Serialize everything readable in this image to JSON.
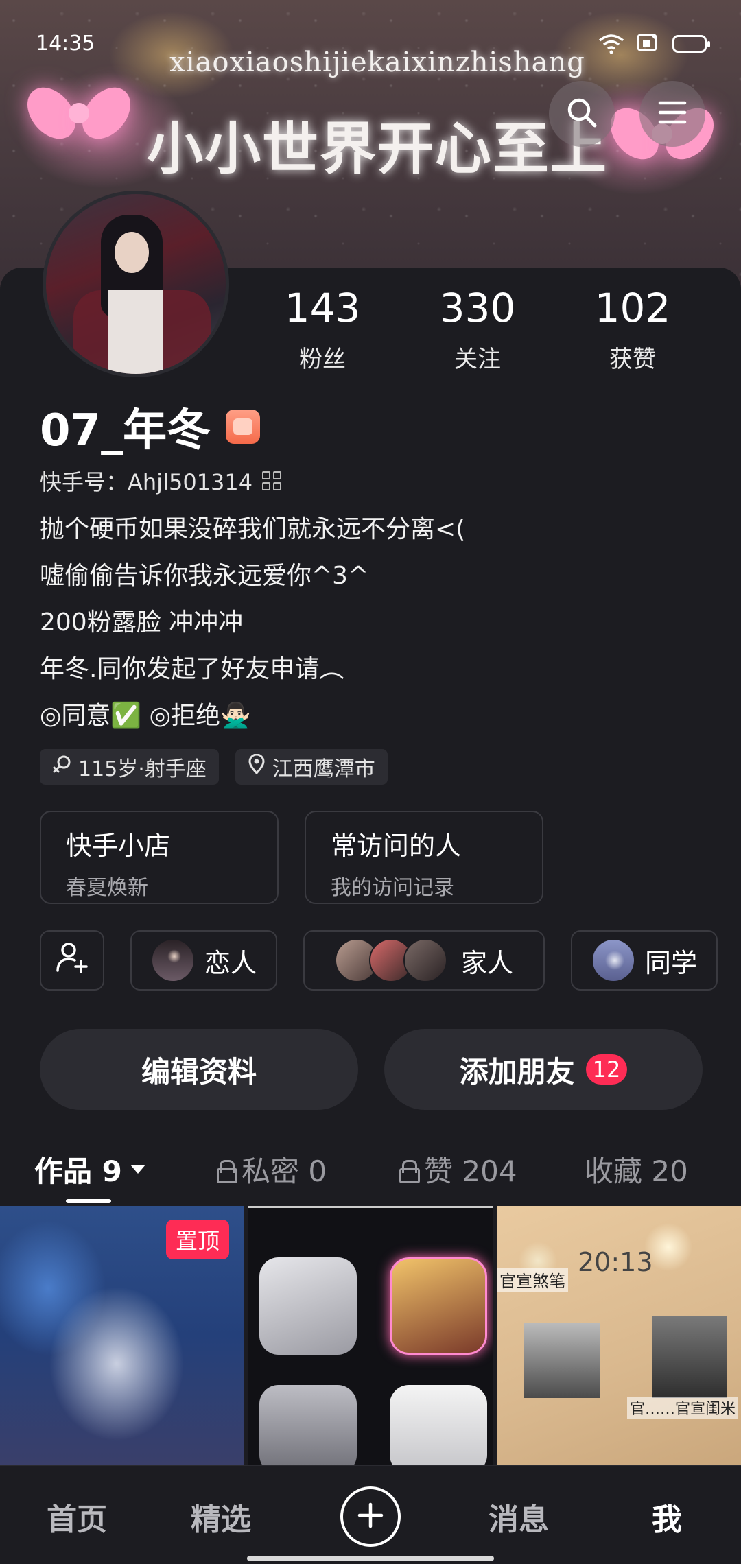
{
  "status_bar": {
    "time": "14:35"
  },
  "banner": {
    "subtitle": "xiaoxiaoshijiekaixinzhishang",
    "title": "小小世界开心至上"
  },
  "header": {
    "search_icon": "search-icon",
    "menu_icon": "menu-icon"
  },
  "stats": [
    {
      "value": "143",
      "label": "粉丝"
    },
    {
      "value": "330",
      "label": "关注"
    },
    {
      "value": "102",
      "label": "获赞"
    }
  ],
  "profile": {
    "name": "07_年冬",
    "kuaishou_id": "快手号：Ahjl501314",
    "bio": [
      "抛个硬币如果没碎我们就永远不分离<(",
      "嘘偷偷告诉你我永远爱你^3^",
      "200粉露脸 冲冲冲",
      "年冬.同你发起了好友申请︵",
      "◎同意✅        ◎拒绝🙅🏻‍♂️"
    ]
  },
  "tags": [
    {
      "icon": "gender-icon",
      "label": "115岁·射手座"
    },
    {
      "icon": "location-icon",
      "label": "江西鹰潭市"
    }
  ],
  "cards": [
    {
      "title": "快手小店",
      "subtitle": "春夏焕新"
    },
    {
      "title": "常访问的人",
      "subtitle": "我的访问记录"
    }
  ],
  "relations": {
    "lover": "恋人",
    "family": "家人",
    "classmate": "同学"
  },
  "actions": {
    "edit": "编辑资料",
    "add_friend": "添加朋友",
    "add_friend_badge": "12"
  },
  "tabs": [
    {
      "label": "作品",
      "count": "9"
    },
    {
      "label": "私密",
      "count": "0"
    },
    {
      "label": "赞",
      "count": "204"
    },
    {
      "label": "收藏",
      "count": "20"
    }
  ],
  "grid": {
    "pin_label": "置顶",
    "clock_text": "20:13",
    "watermark_1": "官宣煞笔",
    "watermark_2": "官……官宣闺米"
  },
  "nav": {
    "home": "首页",
    "featured": "精选",
    "messages": "消息",
    "me": "我"
  },
  "colors": {
    "accent": "#fe2c55",
    "background": "#1c1c21",
    "card": "#2c2c32"
  }
}
